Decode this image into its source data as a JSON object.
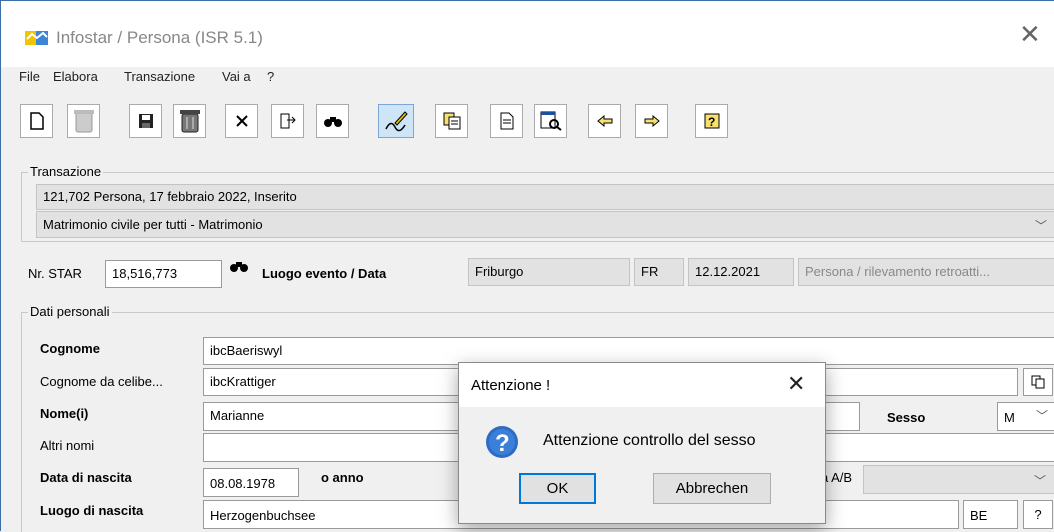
{
  "window": {
    "title": "Infostar / Persona (ISR 5.1)"
  },
  "menu": [
    "File",
    "Elabora",
    "Transazione",
    "Vai a",
    "?"
  ],
  "toolbar": {
    "icons": [
      "new-document-icon",
      "delete-disabled-icon",
      "save-icon",
      "trash-icon",
      "cancel-x-icon",
      "insert-icon",
      "search-binoculars-icon",
      "edit-sign-icon",
      "copy-icon",
      "document-icon",
      "find-document-icon",
      "arrow-left-icon",
      "arrow-right-icon",
      "help-icon"
    ]
  },
  "transazione": {
    "legend": "Transazione",
    "line1": "121,702  Persona, 17 febbraio 2022, Inserito",
    "select": "Matrimonio civile per tutti - Matrimonio"
  },
  "star": {
    "label": "Nr. STAR",
    "value": "18,516,773",
    "luogo_label": "Luogo evento / Data",
    "luogo": "Friburgo",
    "canton": "FR",
    "date": "12.12.2021",
    "tipo": "Persona / rilevamento retroatti..."
  },
  "dati": {
    "legend": "Dati personali",
    "cognome_label": "Cognome",
    "cognome": "ibcBaeriswyl",
    "celibe_label": "Cognome da celibe...",
    "celibe": "ibcKrattiger",
    "nome_label": "Nome(i)",
    "nome": "Marianne",
    "sesso_label": "Sesso",
    "sesso": "M",
    "altri_label": "Altri nomi",
    "altri": "",
    "nascita_label": "Data di nascita",
    "nascita": "08.08.1978",
    "anno_label": "o anno",
    "ab_label": "a A/B",
    "luogo_nascita_label": "Luogo di nascita",
    "luogo_nascita": "Herzogenbuchsee",
    "luogo_nascita_canton": "BE",
    "help": "?"
  },
  "dialog": {
    "title": "Attenzione !",
    "message": "Attenzione controllo del sesso",
    "ok": "OK",
    "cancel": "Abbrechen"
  }
}
